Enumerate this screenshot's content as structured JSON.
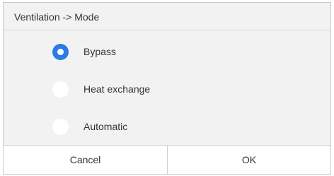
{
  "dialog": {
    "title": "Ventilation -> Mode",
    "options": [
      {
        "label": "Bypass",
        "selected": true
      },
      {
        "label": "Heat exchange",
        "selected": false
      },
      {
        "label": "Automatic",
        "selected": false
      }
    ],
    "cancel_label": "Cancel",
    "ok_label": "OK"
  },
  "colors": {
    "accent": "#2a7be4",
    "background": "#f2f2f2",
    "text": "#333333"
  }
}
